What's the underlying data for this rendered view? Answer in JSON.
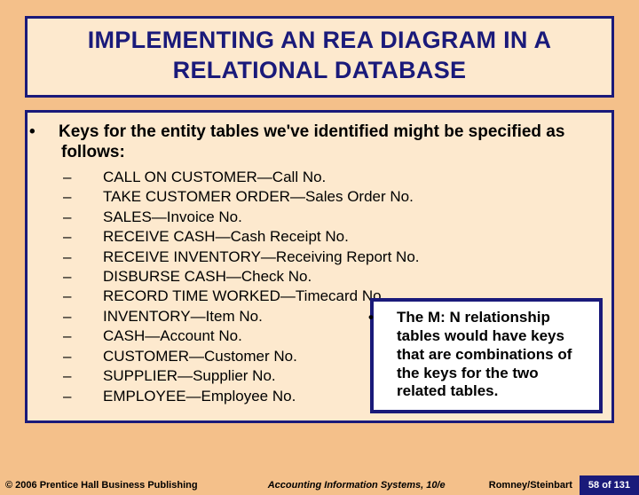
{
  "title": "IMPLEMENTING AN REA DIAGRAM IN A RELATIONAL DATABASE",
  "intro": "Keys for the entity tables we've identified might be specified as follows:",
  "items": [
    "CALL ON CUSTOMER—Call No.",
    "TAKE CUSTOMER ORDER—Sales Order No.",
    "SALES—Invoice No.",
    "RECEIVE CASH—Cash Receipt No.",
    "RECEIVE INVENTORY—Receiving Report No.",
    "DISBURSE CASH—Check No.",
    "RECORD TIME WORKED—Timecard No.",
    "INVENTORY—Item No.",
    "CASH—Account No.",
    "CUSTOMER—Customer No.",
    "SUPPLIER—Supplier No.",
    "EMPLOYEE—Employee No."
  ],
  "callout": "The M: N relationship tables would have keys that are combinations of the keys for the two related tables.",
  "footer": {
    "copyright": "© 2006 Prentice Hall Business Publishing",
    "book": "Accounting Information Systems, 10/e",
    "authors": "Romney/Steinbart",
    "page": "58 of 131"
  }
}
